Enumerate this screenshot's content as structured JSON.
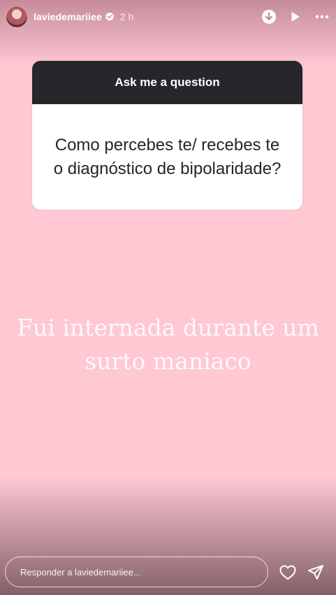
{
  "header": {
    "username": "laviedemariiee",
    "time": "2 h",
    "verified_icon": "verified-badge-icon",
    "actions": [
      "download-icon",
      "play-icon",
      "more-icon"
    ]
  },
  "question_sticker": {
    "title": "Ask me a question",
    "question": "Como percebes te/ recebes te o diagnóstico de bipolaridade?"
  },
  "answer": {
    "text": "Fui internada durante um surto maniaco"
  },
  "footer": {
    "reply_placeholder": "Responder a laviedemariiee...",
    "icons": [
      "heart-icon",
      "send-icon"
    ]
  },
  "colors": {
    "background": "#ffc8d3",
    "sticker_header": "#26272b",
    "sticker_body": "#ffffff",
    "text_dark": "#262626"
  }
}
